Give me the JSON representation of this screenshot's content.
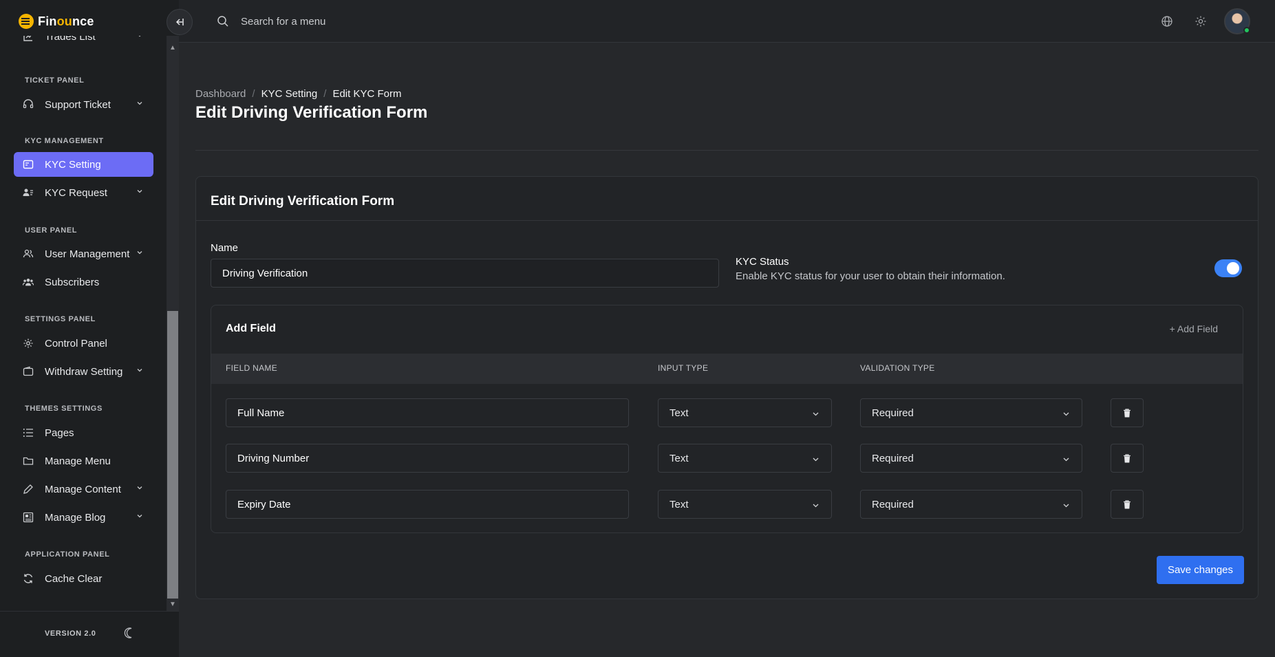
{
  "app": {
    "logo_prefix": "Fin",
    "logo_highlight": "ou",
    "logo_suffix": "nce"
  },
  "sidebar": {
    "partial_item": "Trades List",
    "sections": {
      "ticket": "TICKET PANEL",
      "kyc": "KYC MANAGEMENT",
      "user": "USER PANEL",
      "settings": "SETTINGS PANEL",
      "themes": "THEMES SETTINGS",
      "application": "APPLICATION PANEL"
    },
    "items": {
      "support_ticket": "Support Ticket",
      "kyc_setting": "KYC Setting",
      "kyc_request": "KYC Request",
      "user_management": "User Management",
      "subscribers": "Subscribers",
      "control_panel": "Control Panel",
      "withdraw_setting": "Withdraw Setting",
      "pages": "Pages",
      "manage_menu": "Manage Menu",
      "manage_content": "Manage Content",
      "manage_blog": "Manage Blog",
      "cache_clear": "Cache Clear"
    },
    "active_item": "KYC Setting",
    "version": "VERSION 2.0"
  },
  "topbar": {
    "search_placeholder": "Search for a menu"
  },
  "breadcrumb": [
    "Dashboard",
    "KYC Setting",
    "Edit KYC Form"
  ],
  "page_title": "Edit Driving Verification Form",
  "form": {
    "card_title": "Edit Driving Verification Form",
    "name_label": "Name",
    "name_value": "Driving Verification",
    "kyc_status_title": "KYC Status",
    "kyc_status_desc": "Enable KYC status for your user to obtain their information.",
    "kyc_status_enabled": true,
    "add_field_title": "Add Field",
    "add_field_button": "+ Add Field",
    "columns": [
      "FIELD NAME",
      "INPUT TYPE",
      "VALIDATION TYPE"
    ],
    "fields": [
      {
        "name": "Full Name",
        "input_type": "Text",
        "validation": "Required"
      },
      {
        "name": "Driving Number",
        "input_type": "Text",
        "validation": "Required"
      },
      {
        "name": "Expiry Date",
        "input_type": "Text",
        "validation": "Required"
      }
    ],
    "save_button": "Save changes"
  },
  "colors": {
    "accent": "#6c6cf5",
    "primary_button": "#2f6ff0",
    "toggle_on": "#3b82f6",
    "logo": "#f5b400",
    "online": "#22c55e"
  }
}
